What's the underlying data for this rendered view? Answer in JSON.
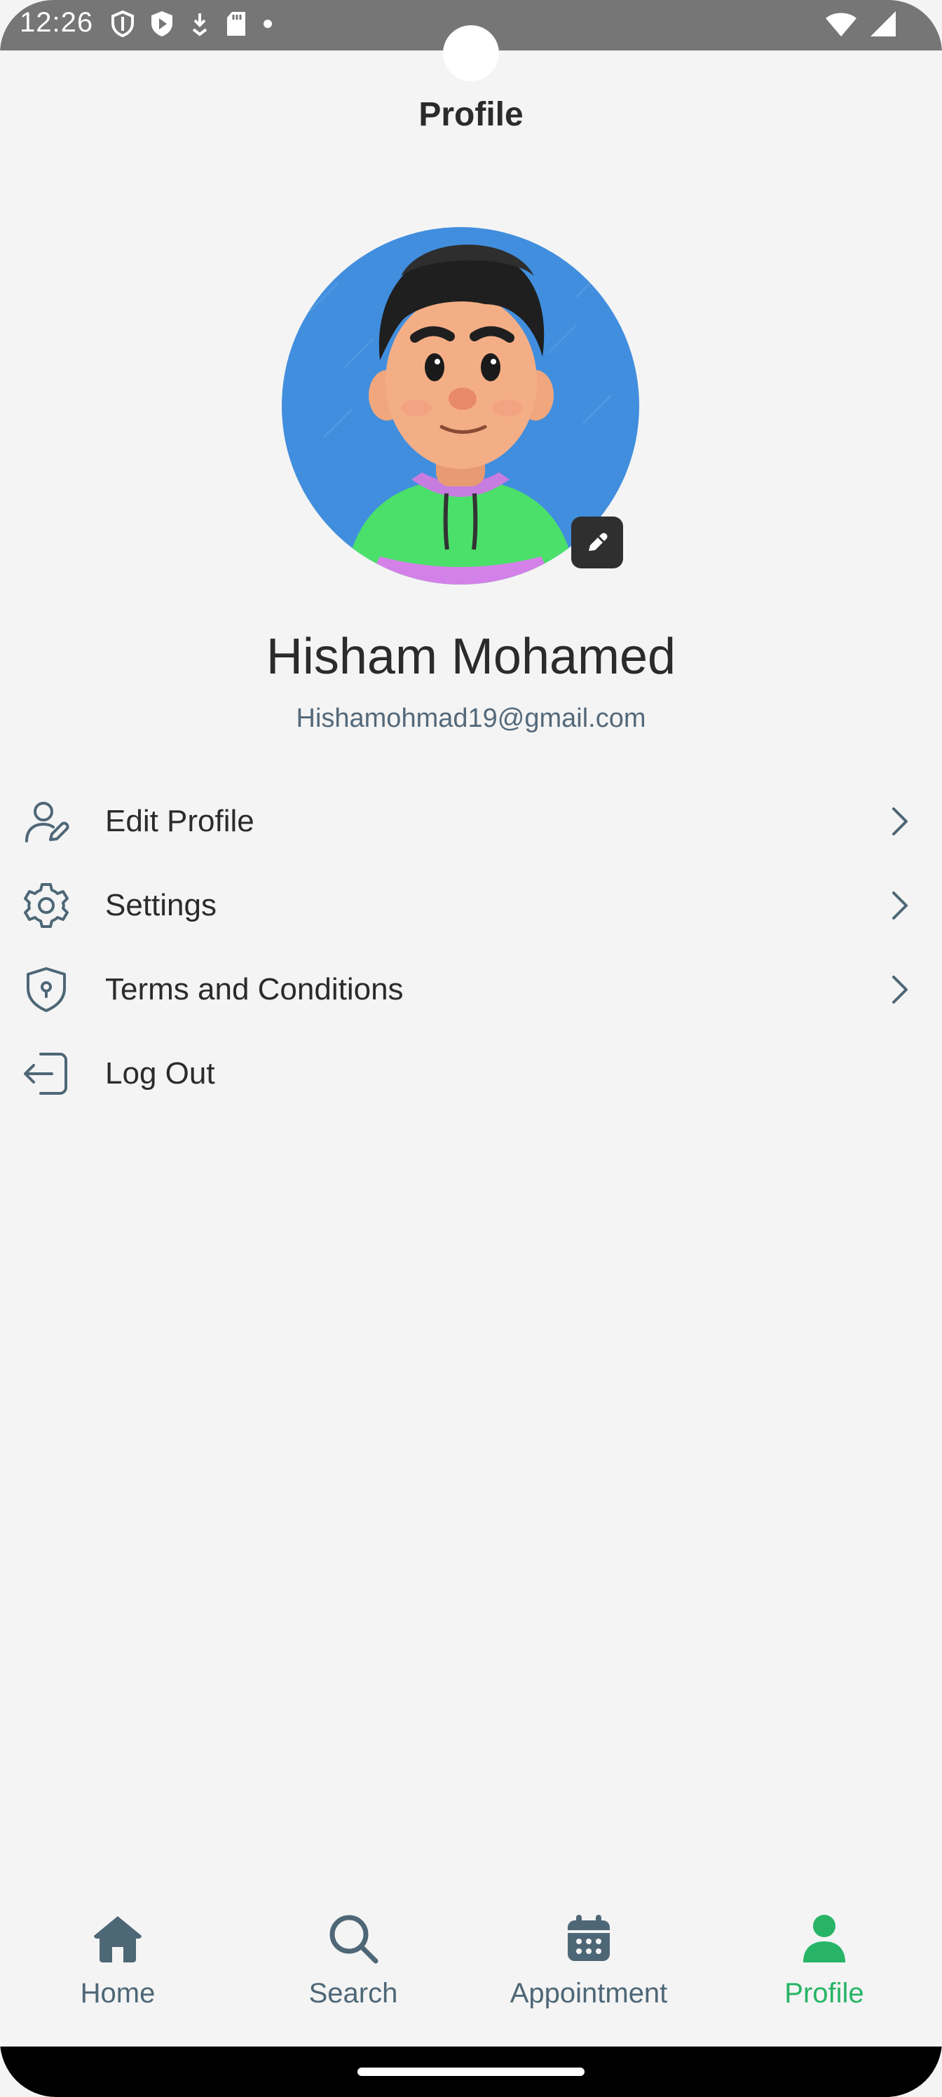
{
  "status_bar": {
    "time": "12:26",
    "icons_left": [
      "shield-icon",
      "play-shield-icon",
      "download-icon",
      "sd-card-icon",
      "dot-icon"
    ],
    "icons_right": [
      "wifi-icon",
      "cellular-signal-icon"
    ]
  },
  "header": {
    "title": "Profile"
  },
  "profile": {
    "name": "Hisham Mohamed",
    "email": "Hishamohmad19@gmail.com",
    "avatar_icon": "avatar-illustration",
    "edit_icon": "pencil-icon"
  },
  "menu": {
    "items": [
      {
        "label": "Edit Profile",
        "icon": "user-edit-icon",
        "has_chevron": true
      },
      {
        "label": "Settings",
        "icon": "gear-icon",
        "has_chevron": true
      },
      {
        "label": "Terms and Conditions",
        "icon": "shield-lock-icon",
        "has_chevron": true
      },
      {
        "label": "Log Out",
        "icon": "logout-icon",
        "has_chevron": false
      }
    ]
  },
  "bottom_nav": {
    "items": [
      {
        "label": "Home",
        "icon": "home-icon",
        "active": false
      },
      {
        "label": "Search",
        "icon": "search-icon",
        "active": false
      },
      {
        "label": "Appointment",
        "icon": "calendar-icon",
        "active": false
      },
      {
        "label": "Profile",
        "icon": "person-icon",
        "active": true
      }
    ]
  },
  "colors": {
    "background": "#f4f4f4",
    "accent_active": "#27b466",
    "nav_inactive": "#4e6777",
    "avatar_bg": "#418ede",
    "email_text": "#54697a"
  }
}
